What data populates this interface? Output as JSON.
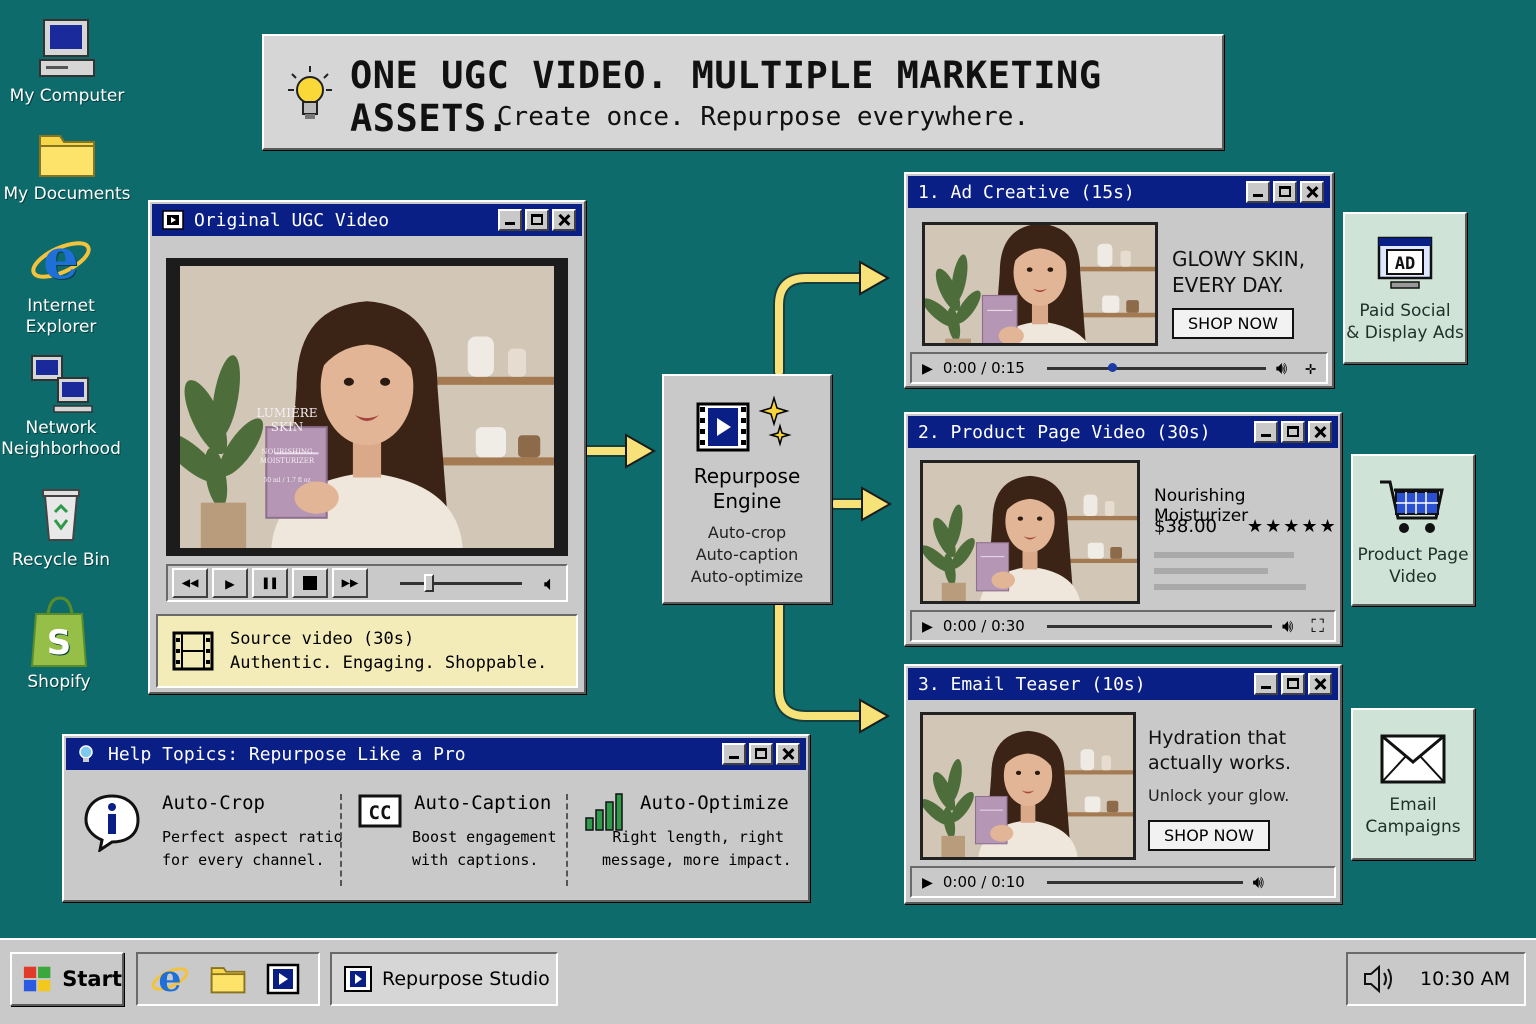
{
  "desktop": {
    "icons": [
      {
        "label": "My Computer",
        "icon": "computer-icon"
      },
      {
        "label": "My Documents",
        "icon": "folder-icon"
      },
      {
        "label": "Internet Explorer",
        "icon": "ie-icon"
      },
      {
        "label": "Network Neighborhood",
        "icon": "network-icon"
      },
      {
        "label": "Recycle Bin",
        "icon": "recycle-bin-icon"
      },
      {
        "label": "Shopify",
        "icon": "shopify-bag-icon"
      }
    ]
  },
  "banner": {
    "headline": "ONE UGC VIDEO. MULTIPLE MARKETING ASSETS.",
    "subline": "Create once. Repurpose everywhere."
  },
  "source_window": {
    "title": "Original UGC Video",
    "product_brand": "LUMIÈRE SKIN",
    "product_name": "NOURISHING MOISTURIZER",
    "product_size": "50 ml / 1.7 fl oz",
    "info_line1": "Source video (30s)",
    "info_line2": "Authentic. Engaging. Shoppable."
  },
  "engine": {
    "title_line1": "Repurpose",
    "title_line2": "Engine",
    "features": [
      "Auto-crop",
      "Auto-caption",
      "Auto-optimize"
    ]
  },
  "outputs": [
    {
      "title": "1. Ad Creative (15s)",
      "headline_line1": "GLOWY SKIN,",
      "headline_line2": "EVERY DAY.",
      "cta": "SHOP NOW",
      "time": "0:00 / 0:15",
      "progress": 0.28,
      "card_line1": "Paid Social",
      "card_line2": "& Display Ads",
      "card_icon": "ad-monitor-icon",
      "card_badge": "AD"
    },
    {
      "title": "2. Product Page Video (30s)",
      "product": "Nourishing Moisturizer",
      "price": "$38.00",
      "stars": "★★★★★",
      "time": "0:00 / 0:30",
      "card_line1": "Product Page",
      "card_line2": "Video",
      "card_icon": "shopping-cart-icon"
    },
    {
      "title": "3. Email Teaser (10s)",
      "headline_line1": "Hydration that",
      "headline_line2": "actually works.",
      "subline": "Unlock your glow.",
      "cta": "SHOP NOW",
      "time": "0:00 / 0:10",
      "card_line1": "Email",
      "card_line2": "Campaigns",
      "card_icon": "envelope-icon"
    }
  ],
  "help_window": {
    "title": "Help Topics: Repurpose Like a Pro",
    "topics": [
      {
        "icon": "info-bubble-icon",
        "title": "Auto-Crop",
        "line1": "Perfect aspect ratio",
        "line2": "for every channel."
      },
      {
        "icon": "closed-caption-icon",
        "title": "Auto-Caption",
        "line1": "Boost engagement",
        "line2": "with captions."
      },
      {
        "icon": "bar-chart-icon",
        "title": "Auto-Optimize",
        "line1": "Right length, right",
        "line2": "message, more impact."
      }
    ]
  },
  "taskbar": {
    "start_label": "Start",
    "task_label": "Repurpose Studio",
    "clock": "10:30 AM"
  },
  "colors": {
    "desktop": "#0e6b6b",
    "titlebar": "#0a1f86",
    "arrow": "#f7e27a",
    "info_panel": "#f3ecb8",
    "card": "#cfe4d7"
  }
}
